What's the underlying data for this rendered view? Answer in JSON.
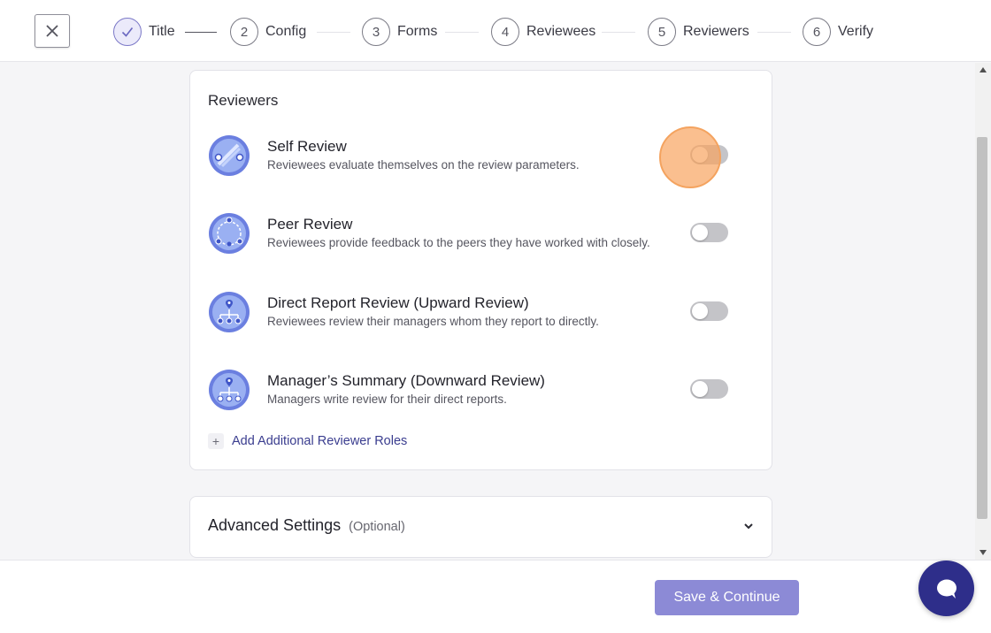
{
  "stepper": {
    "steps": [
      {
        "number": "1",
        "label": "Title",
        "done": true
      },
      {
        "number": "2",
        "label": "Config"
      },
      {
        "number": "3",
        "label": "Forms"
      },
      {
        "number": "4",
        "label": "Reviewees"
      },
      {
        "number": "5",
        "label": "Reviewers"
      },
      {
        "number": "6",
        "label": "Verify"
      }
    ]
  },
  "reviewers": {
    "title": "Reviewers",
    "roles": [
      {
        "name": "Self Review",
        "description": "Reviewees evaluate themselves on the review parameters.",
        "enabled": false,
        "icon": "self-review-icon"
      },
      {
        "name": "Peer Review",
        "description": "Reviewees provide feedback to the peers they have worked with closely.",
        "enabled": false,
        "icon": "peer-review-icon"
      },
      {
        "name": "Direct Report Review (Upward Review)",
        "description": "Reviewees review their managers whom they report to directly.",
        "enabled": false,
        "icon": "upward-review-icon"
      },
      {
        "name": "Manager’s Summary (Downward Review)",
        "description": "Managers write review for their direct reports.",
        "enabled": false,
        "icon": "downward-review-icon"
      }
    ],
    "add_label": "Add Additional Reviewer Roles"
  },
  "advanced": {
    "title": "Advanced Settings",
    "optional": "(Optional)"
  },
  "footer": {
    "save_label": "Save & Continue"
  },
  "colors": {
    "accent": "#8c8ad6",
    "chat": "#2e2e8a",
    "link": "#3a3d8f",
    "highlight": "#f4a35f"
  }
}
